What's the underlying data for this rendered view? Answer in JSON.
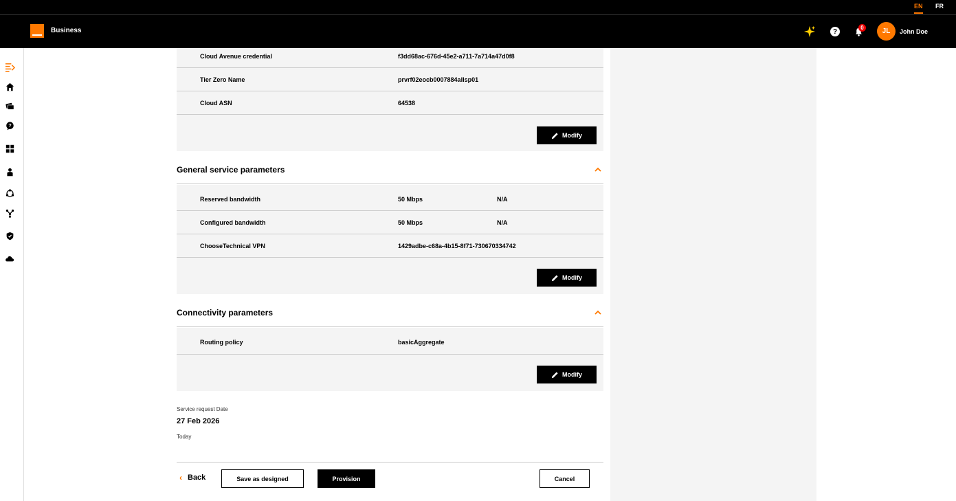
{
  "lang": {
    "en": "EN",
    "fr": "FR",
    "active": "EN"
  },
  "header": {
    "brand": "Business",
    "notifications": "0",
    "avatar_initials": "JL",
    "user_name": "John Doe"
  },
  "sidebar": {
    "items": [
      "menu-toggle",
      "home",
      "tickets",
      "help",
      "dashboard",
      "user",
      "network",
      "topology",
      "security",
      "cloud"
    ]
  },
  "cloud_section": {
    "rows": [
      {
        "label": "Cloud Avenue credential",
        "value": "f3dd68ac-676d-45e2-a711-7a714a47d0f8"
      },
      {
        "label": "Tier Zero Name",
        "value": "prvrf02eocb0007884allsp01"
      },
      {
        "label": "Cloud ASN",
        "value": "64538"
      }
    ],
    "modify_label": "Modify"
  },
  "general_section": {
    "title": "General service parameters",
    "rows": [
      {
        "label": "Reserved bandwidth",
        "value": "50 Mbps",
        "value2": "N/A"
      },
      {
        "label": "Configured bandwidth",
        "value": "50 Mbps",
        "value2": "N/A"
      },
      {
        "label": "ChooseTechnical VPN",
        "value": "1429adbe-c68a-4b15-8f71-730670334742",
        "value2": ""
      }
    ],
    "modify_label": "Modify"
  },
  "connectivity_section": {
    "title": "Connectivity parameters",
    "rows": [
      {
        "label": "Routing policy",
        "value": "basicAggregate"
      }
    ],
    "modify_label": "Modify"
  },
  "service_request": {
    "label": "Service request Date",
    "date": "27 Feb 2026",
    "hint": "Today"
  },
  "footer": {
    "back": "Back",
    "save": "Save as designed",
    "provision": "Provision",
    "cancel": "Cancel"
  },
  "colors": {
    "accent": "#ff7900",
    "header_bg": "#000000",
    "panel_bg": "#f4f4f4"
  }
}
